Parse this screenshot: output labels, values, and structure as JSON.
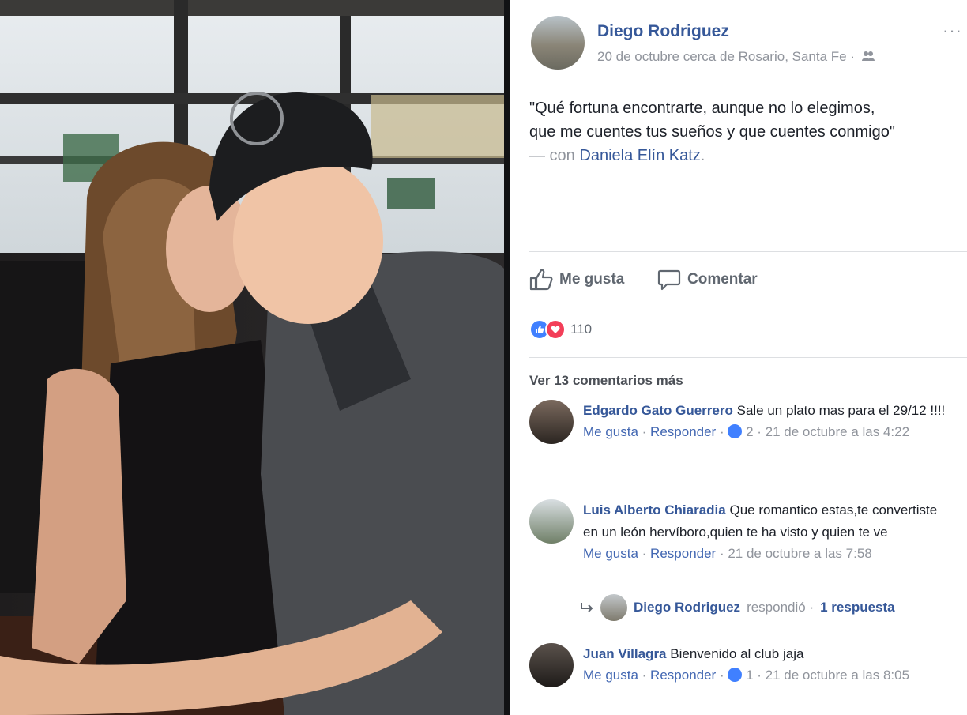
{
  "colors": {
    "link": "#365899",
    "secondary_text": "#90949c",
    "like_blue": "#4080ff",
    "love_red": "#f33e58",
    "divider": "#dddfe2"
  },
  "post": {
    "author": "Diego Rodriguez",
    "meta": "20 de octubre cerca de Rosario, Santa Fe ·",
    "audience_icon": "friends-icon",
    "more_icon": "···",
    "quote_line1": "\"Qué fortuna encontrarte, aunque no lo elegimos,",
    "quote_line2": "que me cuentes tus sueños y que cuentes conmigo\"",
    "with_prefix": "— con",
    "tagged": "Daniela Elín Katz",
    "tagged_suffix": "."
  },
  "actions": {
    "like_label": "Me gusta",
    "like_icon": "thumbs-up-icon",
    "comment_label": "Comentar",
    "comment_icon": "speech-bubble-icon"
  },
  "reactions": {
    "count": "110",
    "types": [
      "like-icon",
      "love-icon"
    ]
  },
  "comments_link": "Ver 13 comentarios más",
  "comments": [
    {
      "author": "Edgardo Gato Guerrero",
      "text": "Sale un plato mas para el 29/12 !!!!",
      "like": "Me gusta",
      "reply": "Responder",
      "reaction_count": "2",
      "time": "21 de octubre a las 4:22"
    },
    {
      "author": "Luis Alberto Chiaradia",
      "text": "Que romantico estas,te convertiste en un león hervíboro,quien te ha visto y quien te ve",
      "like": "Me gusta",
      "reply": "Responder",
      "time": "21 de octubre a las 7:58"
    },
    {
      "author": "Juan Villagra",
      "text": "Bienvenido al club jaja",
      "like": "Me gusta",
      "reply": "Responder",
      "reaction_count": "1",
      "time": "21 de octubre a las 8:05"
    }
  ],
  "reply_thread": {
    "author": "Diego Rodriguez",
    "action": "respondió ·",
    "count": "1 respuesta"
  }
}
